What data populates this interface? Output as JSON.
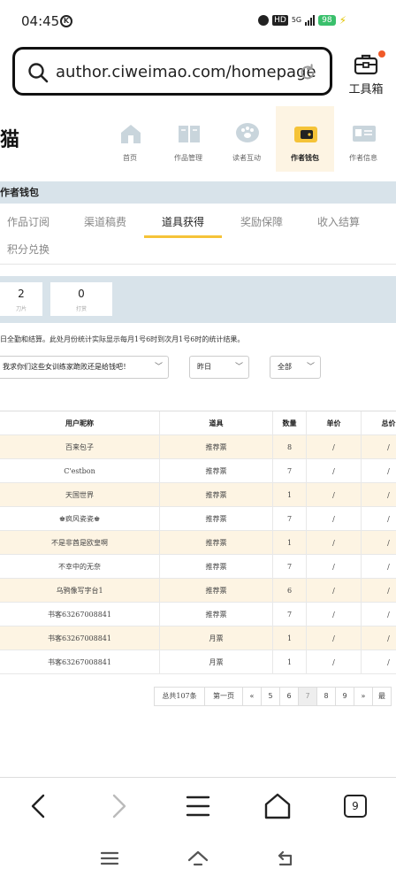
{
  "status_bar": {
    "time": "04:45",
    "network": "5G",
    "hd": "HD",
    "battery": "98"
  },
  "browser": {
    "url": "author.ciweimao.com/homepage",
    "toolbox_label": "工具箱",
    "tabs_count": "9"
  },
  "site": {
    "logo_glyph": "猫",
    "nav": [
      {
        "label": "首页",
        "icon": "home-icon"
      },
      {
        "label": "作品管理",
        "icon": "book-icon"
      },
      {
        "label": "读者互动",
        "icon": "paw-chat-icon"
      },
      {
        "label": "作者钱包",
        "icon": "wallet-icon"
      },
      {
        "label": "作者信息",
        "icon": "id-card-icon"
      }
    ],
    "section_title": "作者钱包"
  },
  "subtabs": [
    "作品订阅",
    "渠道稿费",
    "道具获得",
    "奖励保障",
    "收入结算",
    "积分兑换"
  ],
  "stats": [
    {
      "value": "2",
      "caption": "刀片"
    },
    {
      "value": "0",
      "caption": "打赏"
    }
  ],
  "note": "日全勤和结算。此处月份统计实际显示每月1号6时到次月1号6时的统计结果。",
  "filters": {
    "book": "我求你们这些女训练家跪败还是给钱吧！",
    "period": "昨日",
    "type": "全部"
  },
  "table": {
    "headers": [
      "用户昵称",
      "道具",
      "数量",
      "单价",
      "总价"
    ],
    "rows": [
      [
        "百来包子",
        "推荐票",
        "8",
        "/",
        "/"
      ],
      [
        "C'estbon",
        "推荐票",
        "7",
        "/",
        "/"
      ],
      [
        "天国世界",
        "推荐票",
        "1",
        "/",
        "/"
      ],
      [
        "♚疯风瓷瓷♚",
        "推荐票",
        "7",
        "/",
        "/"
      ],
      [
        "不是非酋是欧皇啊",
        "推荐票",
        "1",
        "/",
        "/"
      ],
      [
        "不幸中的无奈",
        "推荐票",
        "7",
        "/",
        "/"
      ],
      [
        "乌鸦像写字台1",
        "推荐票",
        "6",
        "/",
        "/"
      ],
      [
        "书客63267008841",
        "推荐票",
        "7",
        "/",
        "/"
      ],
      [
        "书客63267008841",
        "月票",
        "1",
        "/",
        "/"
      ],
      [
        "书客63267008841",
        "月票",
        "1",
        "/",
        "/"
      ]
    ]
  },
  "pagination": {
    "total": "总共107条",
    "first": "第一页",
    "prev": "«",
    "pages": [
      "5",
      "6",
      "7",
      "8",
      "9"
    ],
    "current": "7",
    "next": "»",
    "last": "最"
  },
  "colors": {
    "accent": "#f5c338",
    "active_row": "#fdf4e3",
    "band": "#d8e3ea",
    "notification_dot": "#f05a28"
  }
}
